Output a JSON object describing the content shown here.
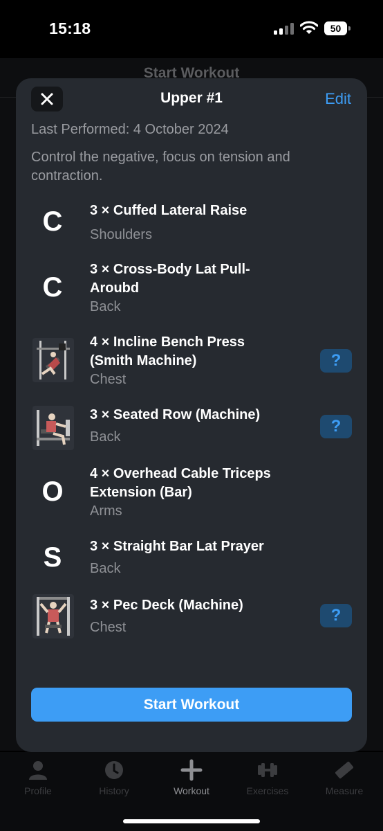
{
  "status": {
    "time": "15:18",
    "battery": "50"
  },
  "background": {
    "title": "Start Workout"
  },
  "sheet": {
    "title": "Upper #1",
    "edit_label": "Edit",
    "last_performed": "Last Performed: 4 October 2024",
    "notes": "Control the negative, focus on tension and contraction.",
    "exercises": [
      {
        "thumb": "C",
        "icon": "letter-avatar",
        "name": "3 × Cuffed Lateral Raise",
        "muscle": "Shoulders"
      },
      {
        "thumb": "C",
        "icon": "letter-avatar",
        "name": "3 × Cross-Body Lat Pull-Aroubd",
        "muscle": "Back"
      },
      {
        "thumb": "",
        "icon": "incline-bench-press-illustration",
        "name": "4 × Incline Bench Press (Smith Machine)",
        "muscle": "Chest",
        "help": "?"
      },
      {
        "thumb": "",
        "icon": "seated-row-illustration",
        "name": "3 × Seated Row (Machine)",
        "muscle": "Back",
        "help": "?"
      },
      {
        "thumb": "O",
        "icon": "letter-avatar",
        "name": "4 × Overhead Cable Triceps Extension (Bar)",
        "muscle": "Arms"
      },
      {
        "thumb": "S",
        "icon": "letter-avatar",
        "name": "3 × Straight Bar Lat Prayer",
        "muscle": "Back"
      },
      {
        "thumb": "",
        "icon": "pec-deck-illustration",
        "name": "3 × Pec Deck (Machine)",
        "muscle": "Chest",
        "help": "?"
      }
    ],
    "start_button": "Start Workout"
  },
  "tabs": [
    {
      "label": "Profile",
      "icon": "person-icon"
    },
    {
      "label": "History",
      "icon": "clock-icon"
    },
    {
      "label": "Workout",
      "icon": "plus-icon",
      "active": true
    },
    {
      "label": "Exercises",
      "icon": "dumbbell-icon"
    },
    {
      "label": "Measure",
      "icon": "ruler-icon"
    }
  ],
  "colors": {
    "accent": "#3d9df5",
    "sheet": "#262a30",
    "help_bg": "#1e4a70"
  }
}
